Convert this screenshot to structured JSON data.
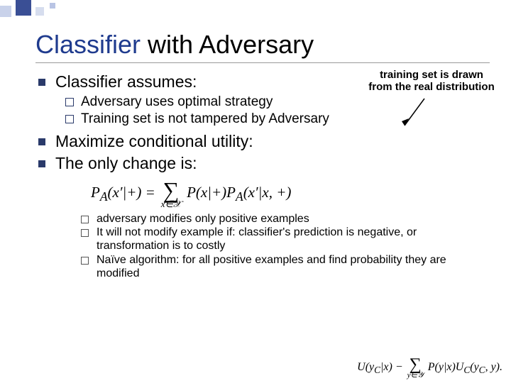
{
  "title": {
    "accent": "Classifier",
    "rest": " with Adversary"
  },
  "annotation": "training set is drawn from the real distribution",
  "bullets": {
    "b1": "Classifier assumes:",
    "b1a": "Adversary uses optimal strategy",
    "b1b": "Training set is not tampered by Adversary",
    "b2": "Maximize conditional utility:",
    "b3": "The only change is:"
  },
  "formula_main": {
    "lhs": "P",
    "lhs_sub": "A",
    "lhs_arg": "(x′|+) = ",
    "sum_sub": "x∈𝒳",
    "rhs1": "P(x|+)P",
    "rhs1_sub": "A",
    "rhs2": "(x′|x, +)"
  },
  "sub_bullets": {
    "s1": "adversary modifies only positive examples",
    "s2": "It will not modify example if: classifier's prediction is negative, or transformation is to costly",
    "s3": "Naïve algorithm: for all positive examples and find probability they are modified"
  },
  "formula_corner": {
    "lhs": "U(y",
    "lhs_sub": "C",
    "lhs2": "|x) − ",
    "sum_sub": "y∈𝒴",
    "rhs": "P(y|x)U",
    "rhs_sub": "C",
    "rhs2": "(y",
    "rhs2_sub": "C",
    "rhs3": ", y)."
  }
}
